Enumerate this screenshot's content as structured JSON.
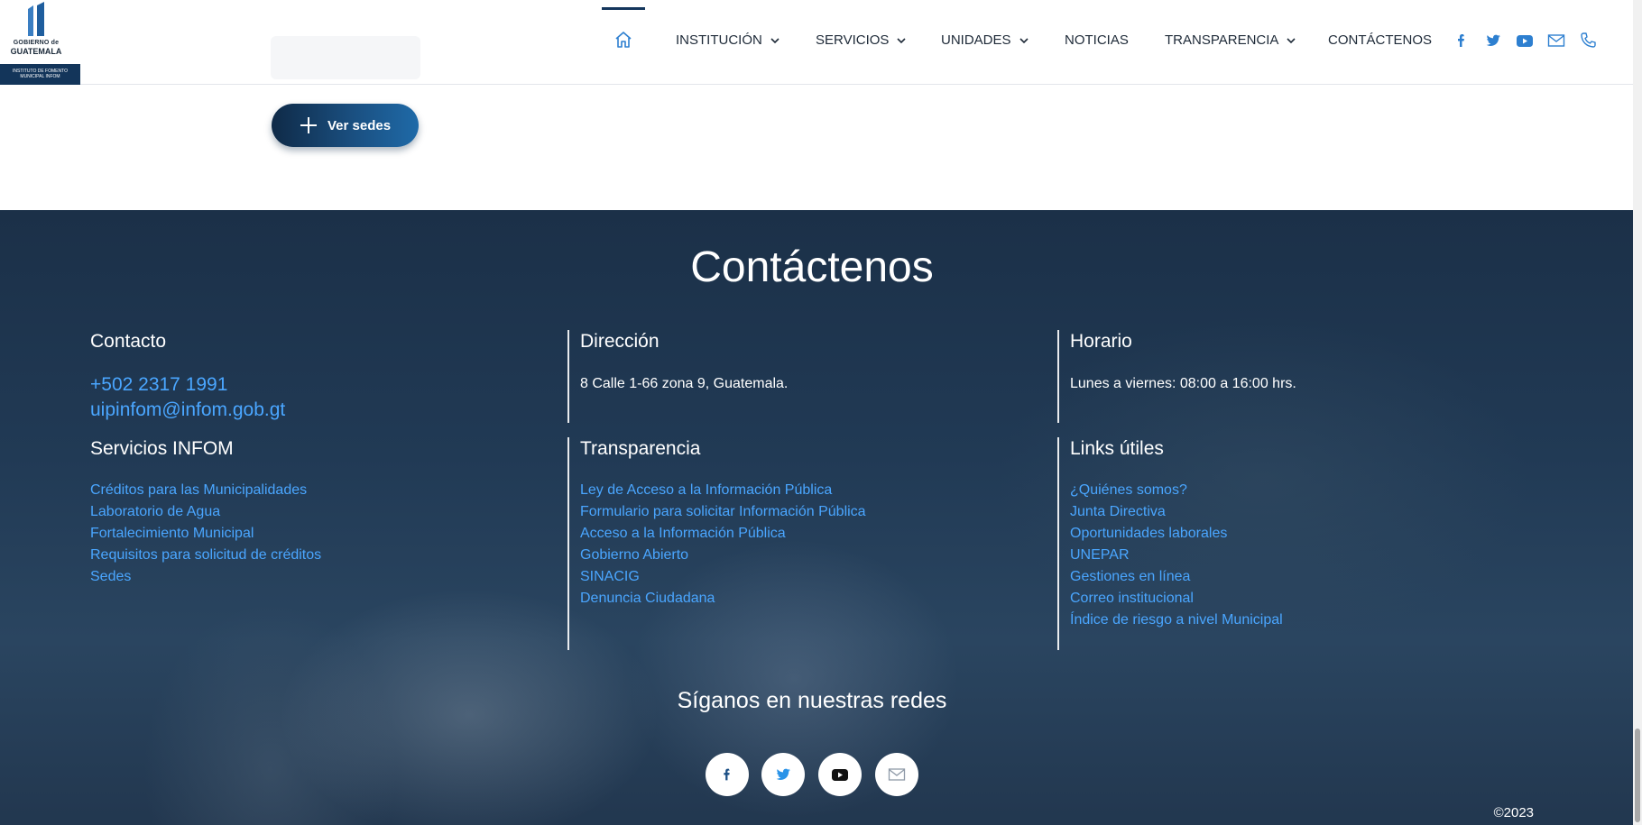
{
  "header": {
    "logo": {
      "line1": "GOBIERNO de",
      "line2": "GUATEMALA",
      "band": "INSTITUTO DE FOMENTO MUNICIPAL INFOM"
    },
    "nav": [
      {
        "label": "INSTITUCIÓN",
        "has_dropdown": true
      },
      {
        "label": "SERVICIOS",
        "has_dropdown": true
      },
      {
        "label": "UNIDADES",
        "has_dropdown": true
      },
      {
        "label": "NOTICIAS",
        "has_dropdown": false
      },
      {
        "label": "TRANSPARENCIA",
        "has_dropdown": true
      },
      {
        "label": "CONTÁCTENOS",
        "has_dropdown": false
      }
    ],
    "social_icons": [
      "facebook-icon",
      "twitter-icon",
      "youtube-icon",
      "mail-icon",
      "phone-icon"
    ]
  },
  "sedes_button": {
    "label": "Ver sedes"
  },
  "footer": {
    "title": "Contáctenos",
    "contacto": {
      "title": "Contacto",
      "phone": "+502 2317 1991",
      "email": "uipinfom@infom.gob.gt"
    },
    "direccion": {
      "title": "Dirección",
      "text": "8 Calle 1-66 zona 9, Guatemala."
    },
    "horario": {
      "title": "Horario",
      "text": "Lunes a viernes: 08:00 a 16:00 hrs."
    },
    "servicios": {
      "title": "Servicios INFOM",
      "links": [
        "Créditos para las Municipalidades",
        "Laboratorio de Agua",
        "Fortalecimiento Municipal",
        "Requisitos para solicitud de créditos",
        "Sedes"
      ]
    },
    "transparencia": {
      "title": "Transparencia",
      "links": [
        "Ley de Acceso a la Información Pública",
        "Formulario para solicitar Información Pública",
        "Acceso a la Información Pública",
        "Gobierno Abierto",
        "SINACIG",
        "Denuncia Ciudadana"
      ]
    },
    "links_utiles": {
      "title": "Links útiles",
      "links": [
        "¿Quiénes somos?",
        "Junta Directiva",
        "Oportunidades laborales",
        "UNEPAR",
        "Gestiones en línea",
        "Correo institucional",
        "Índice de riesgo a nivel Municipal"
      ]
    },
    "follow_title": "Síganos en nuestras redes",
    "social_icons": [
      "facebook-icon",
      "twitter-icon",
      "youtube-icon",
      "mail-icon"
    ],
    "copyright": "©2023"
  },
  "colors": {
    "accent_link": "#4aa6ff",
    "navy": "#14365c",
    "footer_bg": "#1f3650"
  }
}
